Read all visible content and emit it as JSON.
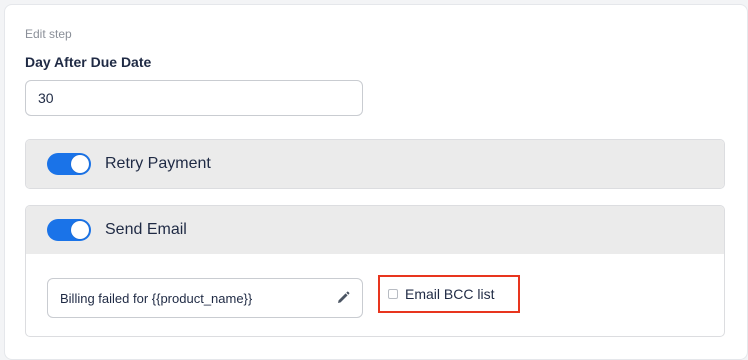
{
  "section_label": "Edit step",
  "day_field": {
    "label": "Day After Due Date",
    "value": "30"
  },
  "retry_payment": {
    "label": "Retry Payment",
    "enabled": true
  },
  "send_email": {
    "label": "Send Email",
    "enabled": true,
    "subject": "Billing failed for {{product_name}}",
    "edit_icon": "pencil-icon",
    "bcc_label": "Email BCC list",
    "bcc_checked": false
  },
  "colors": {
    "toggle_on": "#1a73e8",
    "highlight": "#e8351e",
    "panel_header": "#ebebeb"
  }
}
